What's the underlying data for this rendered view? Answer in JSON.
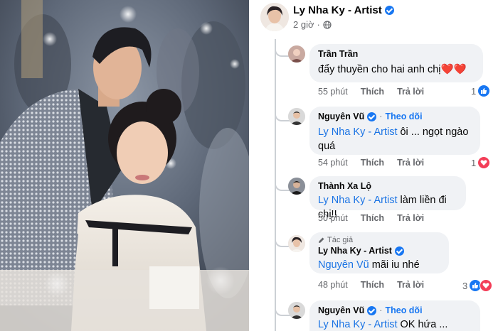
{
  "post": {
    "author": "Ly Nha Ky - Artist",
    "time": "2 giờ",
    "privacy_icon": "globe-icon"
  },
  "comments": [
    {
      "name": "Trần Trần",
      "verified": false,
      "text": "đẩy thuyền cho hai anh chị",
      "emoji": "❤️❤️",
      "time": "55 phút",
      "like_label": "Thích",
      "reply_label": "Trả lời",
      "reaction_count": "1",
      "reaction_type": "like-icon"
    },
    {
      "name": "Nguyên Vũ",
      "verified": true,
      "follow": "Theo dõi",
      "mention": "Ly Nha Ky - Artist",
      "text": " ôi ... ngọt ngào quá",
      "time": "54 phút",
      "like_label": "Thích",
      "reply_label": "Trả lời",
      "reaction_count": "1",
      "reaction_type": "love-icon"
    },
    {
      "name": "Thành Xa Lộ",
      "verified": false,
      "mention": "Ly Nha Ky - Artist",
      "text": " làm liền đi chị!!",
      "time": "50 phút",
      "like_label": "Thích",
      "reply_label": "Trả lời"
    },
    {
      "author_tag": "Tác giả",
      "name": "Ly Nha Ky - Artist",
      "verified": true,
      "mention": "Nguyên Vũ",
      "text": " mãi iu nhé",
      "time": "48 phút",
      "like_label": "Thích",
      "reply_label": "Trả lời",
      "reaction_count": "3",
      "reaction_type": "like-love-icons"
    },
    {
      "name": "Nguyên Vũ",
      "verified": true,
      "follow": "Theo dõi",
      "mention": "Ly Nha Ky - Artist",
      "text": " OK hứa ..."
    }
  ],
  "colors": {
    "accent": "#1877f2",
    "love": "#f33e58",
    "bubble": "#f0f2f5"
  }
}
